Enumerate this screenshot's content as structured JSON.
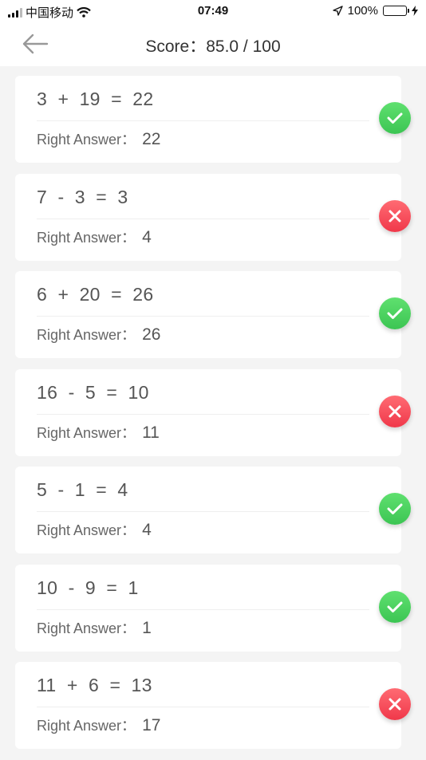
{
  "status": {
    "carrier": "中国移动",
    "time": "07:49",
    "battery": "100%"
  },
  "header": {
    "title": "Score：85.0 / 100"
  },
  "answer_label": "Right Answer：",
  "items": [
    {
      "question": "3  +  19  =  22",
      "answer": "22",
      "correct": true
    },
    {
      "question": "7  -  3  =  3",
      "answer": "4",
      "correct": false
    },
    {
      "question": "6  +  20  =  26",
      "answer": "26",
      "correct": true
    },
    {
      "question": "16  -  5  =  10",
      "answer": "11",
      "correct": false
    },
    {
      "question": "5  -  1  =  4",
      "answer": "4",
      "correct": true
    },
    {
      "question": "10  -  9  =  1",
      "answer": "1",
      "correct": true
    },
    {
      "question": "11  +  6  =  13",
      "answer": "17",
      "correct": false
    }
  ],
  "colors": {
    "correct": "#4cd964",
    "wrong": "#f0384a"
  }
}
